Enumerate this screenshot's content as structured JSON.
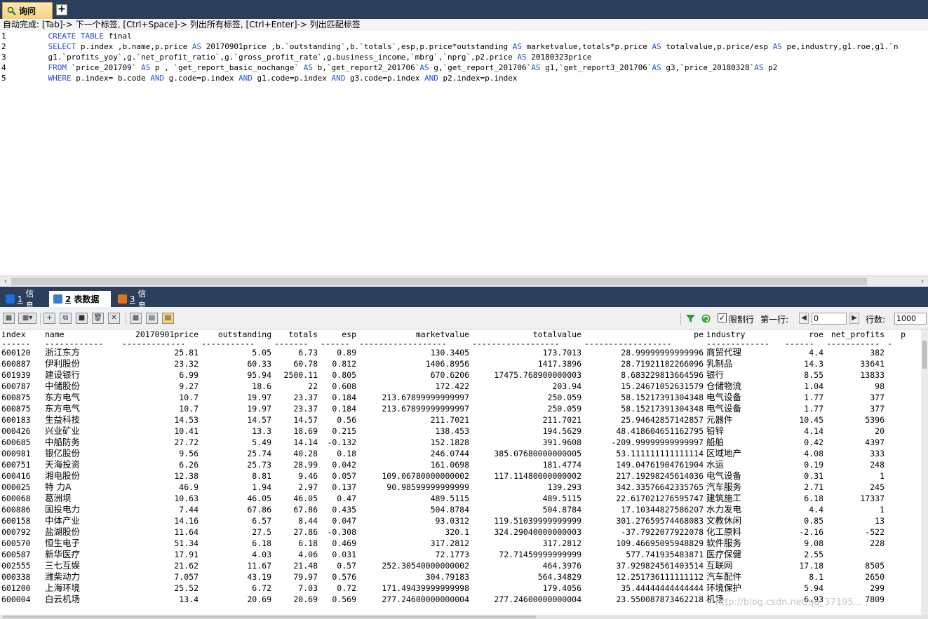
{
  "window": {
    "query_tab_label": "询问",
    "add_tab_symbol": "+"
  },
  "hint": "自动完成: [Tab]-> 下一个标签, [Ctrl+Space]-> 列出所有标签, [Ctrl+Enter]-> 列出匹配标签",
  "editor": {
    "lines": [
      {
        "num": "1",
        "segments": [
          {
            "t": "    "
          },
          {
            "t": "CREATE TABLE",
            "kw": true
          },
          {
            "t": " final"
          }
        ]
      },
      {
        "num": "2",
        "segments": [
          {
            "t": "    "
          },
          {
            "t": "SELECT",
            "kw": true
          },
          {
            "t": " p.index ,b.name,p.price "
          },
          {
            "t": "AS",
            "kw": true
          },
          {
            "t": " 20170901price ,b.`outstanding`,b.`totals`,esp,p.price*outstanding "
          },
          {
            "t": "AS",
            "kw": true
          },
          {
            "t": " marketvalue,totals*p.price "
          },
          {
            "t": "AS",
            "kw": true
          },
          {
            "t": " totalvalue,p.price/esp "
          },
          {
            "t": "AS",
            "kw": true
          },
          {
            "t": " pe,industry,g1.roe,g1.`n"
          }
        ]
      },
      {
        "num": "3",
        "segments": [
          {
            "t": "    g1.`profits_yoy`,g.`net_profit_ratio`,g.`gross_profit_rate`,g.business_income,`mbrg`,`nprg`,p2.price "
          },
          {
            "t": "AS",
            "kw": true
          },
          {
            "t": " 20180323price"
          }
        ]
      },
      {
        "num": "4",
        "segments": [
          {
            "t": "    "
          },
          {
            "t": "FROM",
            "kw": true
          },
          {
            "t": " `price_201709` "
          },
          {
            "t": "AS",
            "kw": true
          },
          {
            "t": " p , `get_report_basic_nochange` "
          },
          {
            "t": "AS",
            "kw": true
          },
          {
            "t": " b,`get_report2_201706`"
          },
          {
            "t": "AS",
            "kw": true
          },
          {
            "t": " g,`get_report_201706`"
          },
          {
            "t": "AS",
            "kw": true
          },
          {
            "t": " g1,`get_report3_201706`"
          },
          {
            "t": "AS",
            "kw": true
          },
          {
            "t": " g3,`price_20180328`"
          },
          {
            "t": "AS",
            "kw": true
          },
          {
            "t": " p2"
          }
        ]
      },
      {
        "num": "5",
        "segments": [
          {
            "t": "    "
          },
          {
            "t": "WHERE",
            "kw": true
          },
          {
            "t": " p.index= b.code "
          },
          {
            "t": "AND",
            "kw": true
          },
          {
            "t": " g.code=p.index "
          },
          {
            "t": "AND",
            "kw": true
          },
          {
            "t": " g1.code=p.index "
          },
          {
            "t": "AND",
            "kw": true
          },
          {
            "t": " g3.code=p.index "
          },
          {
            "t": "AND",
            "kw": true
          },
          {
            "t": " p2.index=p.index"
          }
        ]
      }
    ]
  },
  "bottom_tabs": [
    {
      "num": "1",
      "label": "信息",
      "active": false,
      "icon_color": "#1e6fd9"
    },
    {
      "num": "2",
      "label": "表数据",
      "active": true,
      "icon_color": "#3a7fc4"
    },
    {
      "num": "3",
      "label": "信息",
      "active": false,
      "icon_color": "#e0741f"
    }
  ],
  "toolbar": {
    "limit_checkbox_label": "限制行",
    "limit_checked": true,
    "first_row_label": "第一行:",
    "first_row_value": "0",
    "rows_label": "行数:",
    "rows_value": "1000"
  },
  "grid": {
    "columns": [
      "index",
      "name",
      "20170901price",
      "outstanding",
      "totals",
      "esp",
      "marketvalue",
      "totalvalue",
      "pe",
      "industry",
      "roe",
      "net_profits",
      "p"
    ],
    "dashes": [
      "------",
      "------------",
      "-------------",
      "-----------",
      "-------",
      "------",
      "------------------",
      "------------------",
      "------------------",
      "-------------",
      "------",
      "-----------",
      "-"
    ],
    "rows": [
      [
        "600120",
        "浙江东方",
        "25.81",
        "5.05",
        "6.73",
        "0.89",
        "130.3405",
        "173.7013",
        "28.99999999999996",
        "商贸代理",
        "4.4",
        "382"
      ],
      [
        "600887",
        "伊利股份",
        "23.32",
        "60.33",
        "60.78",
        "0.812",
        "1406.8956",
        "1417.3896",
        "28.71921182266096",
        "乳制品",
        "14.3",
        "33641"
      ],
      [
        "601939",
        "建设银行",
        "6.99",
        "95.94",
        "2500.11",
        "0.805",
        "670.6206",
        "17475.768900000003",
        "8.683229813664596",
        "银行",
        "8.55",
        "13833"
      ],
      [
        "600787",
        "中储股份",
        "9.27",
        "18.6",
        "22",
        "0.608",
        "172.422",
        "203.94",
        "15.24671052631579",
        "仓储物流",
        "1.04",
        "98"
      ],
      [
        "600875",
        "东方电气",
        "10.7",
        "19.97",
        "23.37",
        "0.184",
        "213.67899999999997",
        "250.059",
        "58.15217391304348",
        "电气设备",
        "1.77",
        "377"
      ],
      [
        "600875",
        "东方电气",
        "10.7",
        "19.97",
        "23.37",
        "0.184",
        "213.67899999999997",
        "250.059",
        "58.15217391304348",
        "电气设备",
        "1.77",
        "377"
      ],
      [
        "600183",
        "生益科技",
        "14.53",
        "14.57",
        "14.57",
        "0.56",
        "211.7021",
        "211.7021",
        "25.94642857142857",
        "元器件",
        "10.45",
        "5396"
      ],
      [
        "000426",
        "兴业矿业",
        "10.41",
        "13.3",
        "18.69",
        "0.215",
        "138.453",
        "194.5629",
        "48.418604651162795",
        "铅锌",
        "4.14",
        "20"
      ],
      [
        "600685",
        "中船防务",
        "27.72",
        "5.49",
        "14.14",
        "-0.132",
        "152.1828",
        "391.9608",
        "-209.99999999999997",
        "船舶",
        "0.42",
        "4397"
      ],
      [
        "000981",
        "银亿股份",
        "9.56",
        "25.74",
        "40.28",
        "0.18",
        "246.0744",
        "385.07680000000005",
        "53.111111111111114",
        "区域地产",
        "4.08",
        "333"
      ],
      [
        "600751",
        "天海投资",
        "6.26",
        "25.73",
        "28.99",
        "0.042",
        "161.0698",
        "181.4774",
        "149.04761904761904",
        "水运",
        "0.19",
        "248"
      ],
      [
        "600416",
        "湘电股份",
        "12.38",
        "8.81",
        "9.46",
        "0.057",
        "109.06780000000002",
        "117.11480000000002",
        "217.19298245614036",
        "电气设备",
        "0.31",
        "1"
      ],
      [
        "000025",
        "特 力A",
        "46.9",
        "1.94",
        "2.97",
        "0.137",
        "90.98599999999999",
        "139.293",
        "342.33576642335765",
        "汽车服务",
        "2.71",
        "245"
      ],
      [
        "600068",
        "葛洲坝",
        "10.63",
        "46.05",
        "46.05",
        "0.47",
        "489.5115",
        "489.5115",
        "22.617021276595747",
        "建筑施工",
        "6.18",
        "17337"
      ],
      [
        "600886",
        "国投电力",
        "7.44",
        "67.86",
        "67.86",
        "0.435",
        "504.8784",
        "504.8784",
        "17.10344827586207",
        "水力发电",
        "4.4",
        "1"
      ],
      [
        "600158",
        "中体产业",
        "14.16",
        "6.57",
        "8.44",
        "0.047",
        "93.0312",
        "119.51039999999999",
        "301.27659574468083",
        "文教休闲",
        "0.85",
        "13"
      ],
      [
        "000792",
        "盐湖股份",
        "11.64",
        "27.5",
        "27.86",
        "-0.308",
        "320.1",
        "324.29040000000003",
        "-37.7922077922078",
        "化工原料",
        "-2.16",
        "-522"
      ],
      [
        "600570",
        "恒生电子",
        "51.34",
        "6.18",
        "6.18",
        "0.469",
        "317.2812",
        "317.2812",
        "109.46695095948829",
        "软件服务",
        "9.08",
        "228"
      ],
      [
        "600587",
        "新华医疗",
        "17.91",
        "4.03",
        "4.06",
        "0.031",
        "72.1773",
        "72.71459999999999",
        "577.741935483871",
        "医疗保健",
        "2.55",
        ""
      ],
      [
        "002555",
        "三七互娱",
        "21.62",
        "11.67",
        "21.48",
        "0.57",
        "252.30540000000002",
        "464.3976",
        "37.92982456140351​4",
        "互联网",
        "17.18",
        "8505"
      ],
      [
        "000338",
        "潍柴动力",
        "7.057",
        "43.19",
        "79.97",
        "0.576",
        "304.79183",
        "564.34829",
        "12.251736111111112",
        "汽车配件",
        "8.1",
        "2650"
      ],
      [
        "601200",
        "上海环境",
        "25.52",
        "6.72",
        "7.03",
        "0.72",
        "171.49439999999998",
        "179.4056",
        "35.44444444444444",
        "环境保护",
        "5.94",
        "299"
      ],
      [
        "600004",
        "白云机场",
        "13.4",
        "20.69",
        "20.69",
        "0.569",
        "277.24600000000004",
        "277.24600000000004",
        "23.550087873462218",
        "机场",
        "6.93",
        "7809"
      ]
    ]
  },
  "watermark": "http://blog.csdn.net/qq_37195..."
}
